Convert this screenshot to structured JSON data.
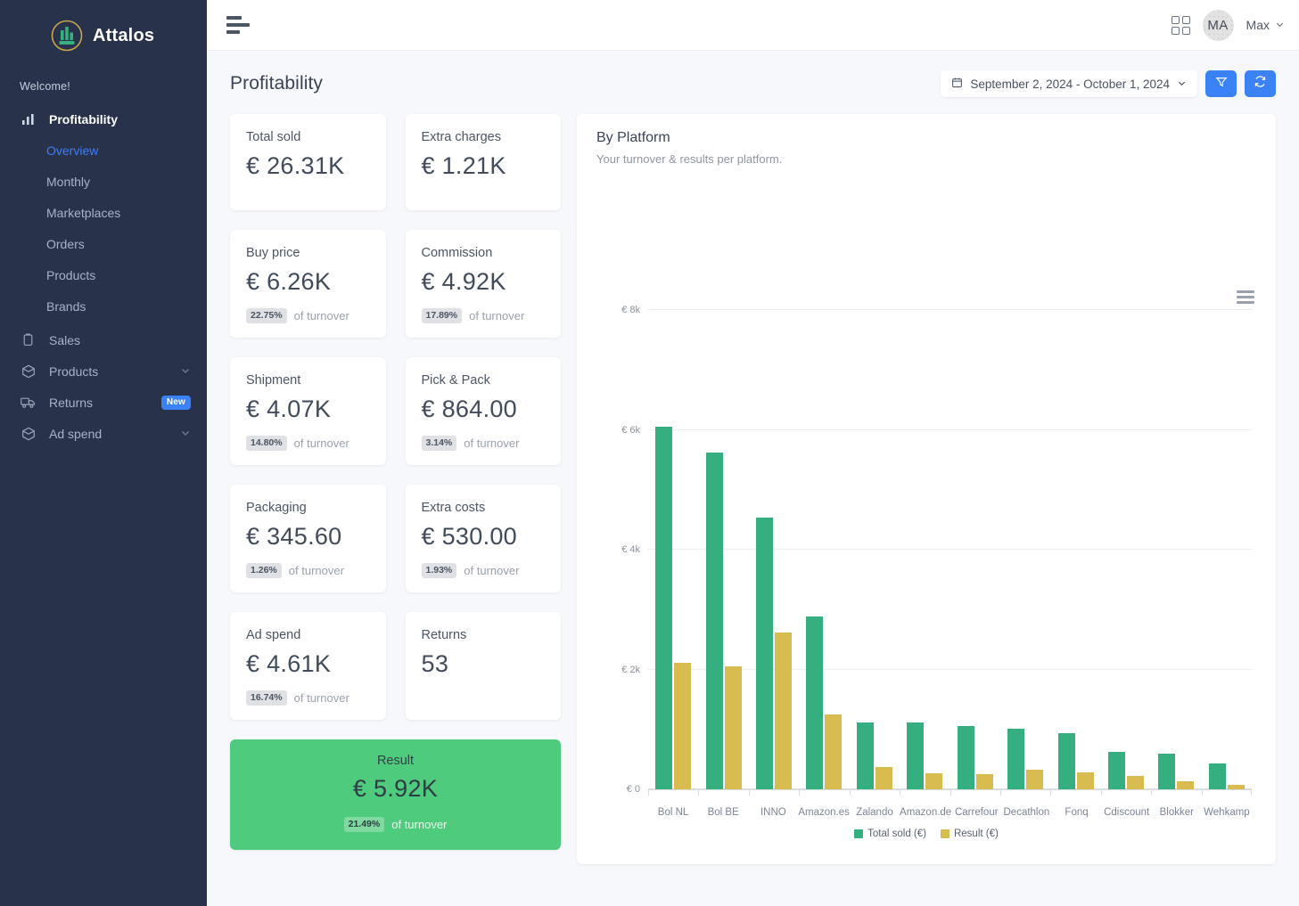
{
  "brand": {
    "name": "Attalos",
    "logo_icon": "bar-chart-circle-logo"
  },
  "sidebar": {
    "welcome": "Welcome!",
    "primary": {
      "label": "Profitability",
      "icon": "bar-chart-icon"
    },
    "sub_items": [
      {
        "label": "Overview",
        "current": true
      },
      {
        "label": "Monthly",
        "current": false
      },
      {
        "label": "Marketplaces",
        "current": false
      },
      {
        "label": "Orders",
        "current": false
      },
      {
        "label": "Products",
        "current": false
      },
      {
        "label": "Brands",
        "current": false
      }
    ],
    "items": [
      {
        "label": "Sales",
        "icon": "clipboard-icon",
        "chevron": false,
        "badge": ""
      },
      {
        "label": "Products",
        "icon": "box-icon",
        "chevron": true,
        "badge": ""
      },
      {
        "label": "Returns",
        "icon": "truck-icon",
        "chevron": false,
        "badge": "New"
      },
      {
        "label": "Ad spend",
        "icon": "box-icon",
        "chevron": true,
        "badge": ""
      }
    ]
  },
  "topbar": {
    "menu_icon": "hamburger-menu-icon",
    "apps_icon": "grid-apps-icon",
    "avatar_initials": "MA",
    "user_name": "Max",
    "user_chevron": "chevron-down-icon"
  },
  "header": {
    "title": "Profitability",
    "date_range": "September 2, 2024 - October 1, 2024",
    "calendar_icon": "calendar-icon",
    "chevron_icon": "chevron-down-icon",
    "filter_icon": "filter-funnel-icon",
    "refresh_icon": "refresh-icon"
  },
  "kpis": [
    {
      "label": "Total sold",
      "value": "€ 26.31K",
      "pct": "",
      "foot": ""
    },
    {
      "label": "Extra charges",
      "value": "€ 1.21K",
      "pct": "",
      "foot": ""
    },
    {
      "label": "Buy price",
      "value": "€ 6.26K",
      "pct": "22.75%",
      "foot": "of turnover"
    },
    {
      "label": "Commission",
      "value": "€ 4.92K",
      "pct": "17.89%",
      "foot": "of turnover"
    },
    {
      "label": "Shipment",
      "value": "€ 4.07K",
      "pct": "14.80%",
      "foot": "of turnover"
    },
    {
      "label": "Pick & Pack",
      "value": "€ 864.00",
      "pct": "3.14%",
      "foot": "of turnover"
    },
    {
      "label": "Packaging",
      "value": "€ 345.60",
      "pct": "1.26%",
      "foot": "of turnover"
    },
    {
      "label": "Extra costs",
      "value": "€ 530.00",
      "pct": "1.93%",
      "foot": "of turnover"
    },
    {
      "label": "Ad spend",
      "value": "€ 4.61K",
      "pct": "16.74%",
      "foot": "of turnover"
    },
    {
      "label": "Returns",
      "value": "53",
      "pct": "",
      "foot": ""
    }
  ],
  "result": {
    "label": "Result",
    "value": "€ 5.92K",
    "pct": "21.49%",
    "foot": "of turnover",
    "color": "#4ecb7c"
  },
  "chart_panel": {
    "title": "By Platform",
    "subtitle": "Your turnover & results per platform.",
    "menu_icon": "chart-menu-icon"
  },
  "chart_data": {
    "type": "bar",
    "title": "By Platform",
    "subtitle": "Your turnover & results per platform.",
    "xlabel": "",
    "ylabel": "",
    "ylim": [
      0,
      8000
    ],
    "yticks": [
      0,
      2000,
      4000,
      6000,
      8000
    ],
    "ytick_labels": [
      "€ 0",
      "€ 2k",
      "€ 4k",
      "€ 6k",
      "€ 8k"
    ],
    "grid": true,
    "legend_position": "bottom",
    "categories": [
      "Bol NL",
      "Bol BE",
      "INNO",
      "Amazon.es",
      "Zalando",
      "Amazon.de",
      "Carrefour",
      "Decathlon",
      "Fonq",
      "Cdiscount",
      "Blokker",
      "Wehkamp"
    ],
    "series": [
      {
        "name": "Total sold (€)",
        "color": "#35af80",
        "values": [
          6050,
          5620,
          4540,
          2880,
          1120,
          1110,
          1060,
          1010,
          930,
          620,
          590,
          430
        ]
      },
      {
        "name": "Result (€)",
        "color": "#d9bc50",
        "values": [
          2110,
          2050,
          2620,
          1250,
          370,
          270,
          255,
          330,
          290,
          220,
          130,
          70
        ]
      }
    ]
  },
  "colors": {
    "accent_blue": "#3b82f6",
    "sidebar_bg": "#28324a",
    "series_green": "#35af80",
    "series_yellow": "#d9bc50",
    "result_green": "#4ecb7c"
  }
}
